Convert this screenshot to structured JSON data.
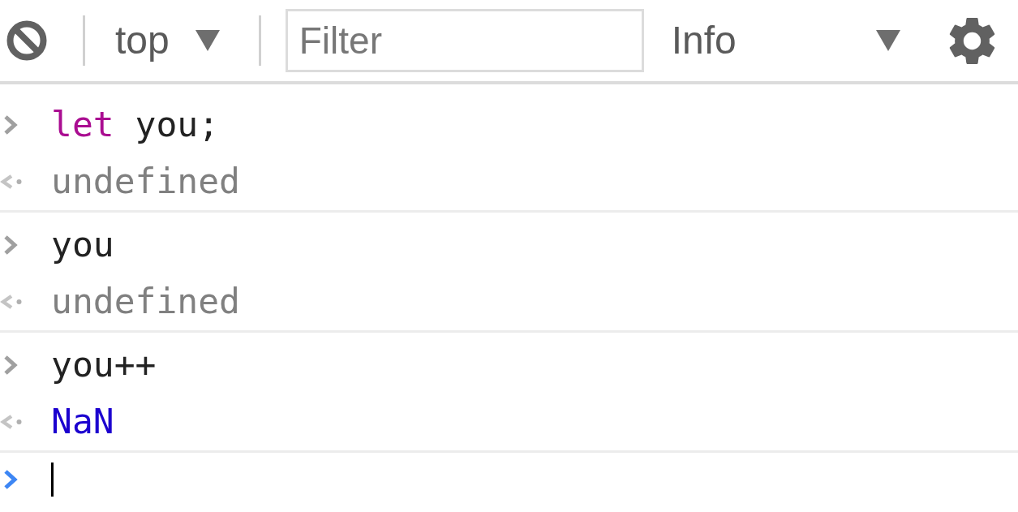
{
  "toolbar": {
    "context": {
      "label": "top"
    },
    "filter": {
      "placeholder": "Filter"
    },
    "level": {
      "label": "Info"
    }
  },
  "entries": [
    {
      "input": {
        "tokens": [
          {
            "kind": "keyword",
            "text": "let"
          },
          {
            "kind": "plain",
            "text": " you;"
          }
        ]
      },
      "result": {
        "kind": "undefined",
        "text": "undefined"
      }
    },
    {
      "input": {
        "tokens": [
          {
            "kind": "plain",
            "text": "you"
          }
        ]
      },
      "result": {
        "kind": "undefined",
        "text": "undefined"
      }
    },
    {
      "input": {
        "tokens": [
          {
            "kind": "plain",
            "text": "you++"
          }
        ]
      },
      "result": {
        "kind": "number",
        "text": "NaN"
      }
    }
  ],
  "prompt": {
    "focused": true
  }
}
